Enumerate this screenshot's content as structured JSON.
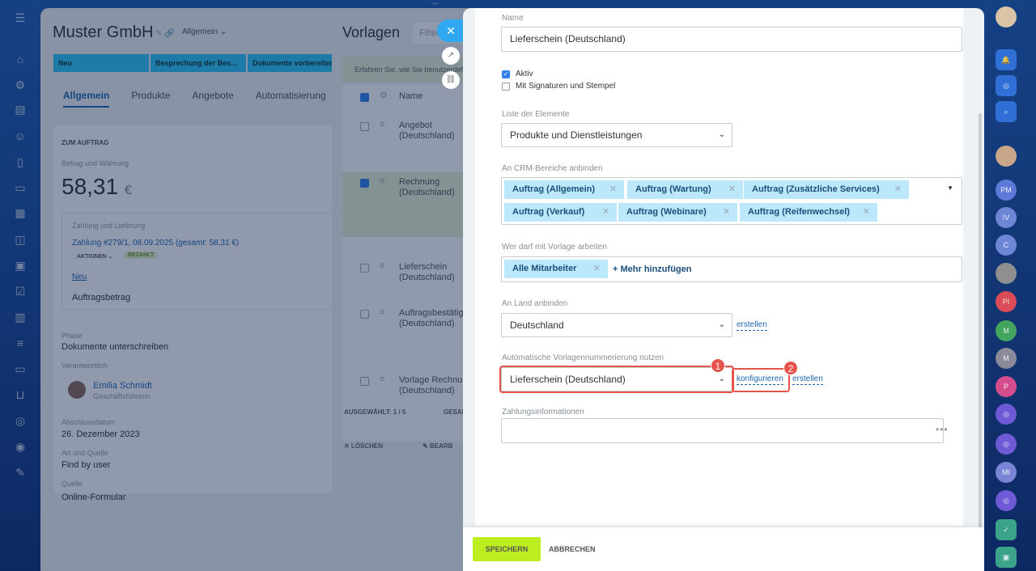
{
  "colors": {
    "accent": "#2f80ed",
    "save_button": "#bbed21",
    "tag_bg": "#bde8fb",
    "annotation": "#e5534b",
    "stage": "#2fc6f6"
  },
  "deal": {
    "title": "Muster GmbH",
    "general_link": "Allgemein ⌄",
    "stages": [
      "Neu",
      "Besprechung der Bes...",
      "Dokumente vorbereiten"
    ],
    "tabs": [
      "Allgemein",
      "Produkte",
      "Angebote",
      "Automatisierung"
    ],
    "section_head": "ZUM AUFTRAG",
    "amount_label": "Betrag und Währung",
    "amount_value": "58,31",
    "amount_currency": "€",
    "payment_label": "Zahlung und Lieferung",
    "payment_link": "Zahlung #279/1, 08.09.2025 (gesamt: 58,31 €)",
    "actions_badge": "AKTIONEN ⌄",
    "paid_badge": "BEZAHLT",
    "new_link": "Neu",
    "order_amount": "Auftragsbetrag",
    "phase_label": "Phase",
    "phase_value": "Dokumente unterschreiben",
    "responsible_label": "Verantwortlich",
    "responsible_name": "Emilia Schmidt",
    "responsible_role": "Geschäftsführerin",
    "date_label": "Abschlussdatum",
    "date_value": "26. Dezember 2023",
    "field_label": "Art und Quelle",
    "field_value": "Find by user",
    "source_label": "Quelle",
    "source_value": "Online-Formular"
  },
  "templates": {
    "title": "Vorlagen",
    "filter_placeholder": "Filter",
    "info_text": "Erfahren Sie, wie Sie benutzerdefinierte",
    "col_name": "Name",
    "rows": [
      {
        "name": "Angebot (Deutschland)",
        "checked": false
      },
      {
        "name": "Rechnung (Deutschland)",
        "checked": true
      },
      {
        "name": "Lieferschein (Deutschland)",
        "checked": false
      },
      {
        "name": "Auftragsbestätigung (Deutschland)",
        "checked": false
      },
      {
        "name": "Vorlage Rechnung (Deutschland)",
        "checked": false
      }
    ],
    "selected": "AUSGEWÄHLT: 1 / 5",
    "total": "GESAMT",
    "delete": "✕ LÖSCHEN",
    "edit": "✎ BEARB"
  },
  "form": {
    "name_label": "Name",
    "name_value": "Lieferschein (Deutschland)",
    "active_label": "Aktiv",
    "sign_label": "Mit Signaturen und Stempel",
    "elements_label": "Liste der Elemente",
    "elements_value": "Produkte und Dienstleistungen",
    "crm_label": "An CRM-Bereiche anbinden",
    "crm_tags": [
      "Auftrag (Allgemein)",
      "Auftrag (Wartung)",
      "Auftrag (Zusätzliche Services)",
      "Auftrag (Verkauf)",
      "Auftrag (Webinare)",
      "Auftrag (Reifenwechsel)"
    ],
    "access_label": "Wer darf mit Vorlage arbeiten",
    "access_tag": "Alle Mitarbeiter",
    "access_more": "+ Mehr hinzufügen",
    "country_label": "An Land anbinden",
    "country_value": "Deutschland",
    "country_create": "erstellen",
    "numbering_label": "Automatische Vorlagennummerierung nutzen",
    "numbering_value": "Lieferschein (Deutschland)",
    "numbering_configure": "konfigurieren",
    "numbering_create": "erstellen",
    "marker_1": "1",
    "marker_2": "2",
    "payment_label": "Zahlungsinformationen",
    "payment_value": "",
    "save": "SPEICHERN",
    "cancel": "ABBRECHEN"
  },
  "right_bar": {
    "avatars": [
      "PM",
      "IV",
      "C",
      "PI",
      "M",
      "M",
      "P",
      "MI"
    ]
  },
  "icons": {
    "close": "✕",
    "chevron": "⌄",
    "open_new": "↗",
    "link": "🔗"
  }
}
